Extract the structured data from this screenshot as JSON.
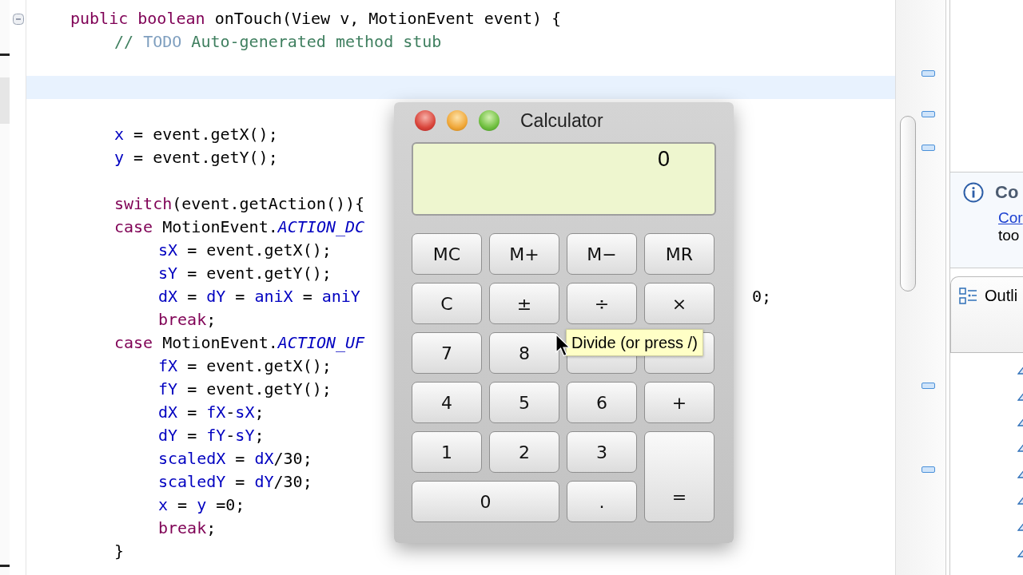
{
  "editor": {
    "lines": [
      {
        "current": false,
        "segments": [
          {
            "kind": "keyword",
            "text": "\tpublic boolean "
          },
          {
            "kind": "plain",
            "text": "onTouch(View v, MotionEvent event) {"
          }
        ]
      },
      {
        "current": false,
        "segments": [
          {
            "kind": "comment",
            "text": "\t\t// "
          },
          {
            "kind": "todo",
            "text": "TODO"
          },
          {
            "kind": "comment",
            "text": " Auto-generated method stub"
          }
        ]
      },
      {
        "current": false
      },
      {
        "current": true
      },
      {
        "current": false
      },
      {
        "current": false,
        "segments": [
          {
            "kind": "field",
            "text": "\t\tx"
          },
          {
            "kind": "plain",
            "text": " = event.getX();"
          }
        ]
      },
      {
        "current": false,
        "segments": [
          {
            "kind": "field",
            "text": "\t\ty"
          },
          {
            "kind": "plain",
            "text": " = event.getY();"
          }
        ]
      },
      {
        "current": false
      },
      {
        "current": false,
        "segments": [
          {
            "kind": "keyword",
            "text": "\t\tswitch"
          },
          {
            "kind": "plain",
            "text": "(event.getAction()){"
          }
        ]
      },
      {
        "current": false,
        "segments": [
          {
            "kind": "keyword",
            "text": "\t\tcase "
          },
          {
            "kind": "plain",
            "text": "MotionEvent."
          },
          {
            "kind": "constant",
            "text": "ACTION_DC"
          }
        ]
      },
      {
        "current": false,
        "segments": [
          {
            "kind": "field",
            "text": "\t\t\tsX"
          },
          {
            "kind": "plain",
            "text": " = event.getX();"
          }
        ]
      },
      {
        "current": false,
        "segments": [
          {
            "kind": "field",
            "text": "\t\t\tsY"
          },
          {
            "kind": "plain",
            "text": " = event.getY();"
          }
        ]
      },
      {
        "current": false,
        "segments": [
          {
            "kind": "field",
            "text": "\t\t\tdX"
          },
          {
            "kind": "plain",
            "text": " = "
          },
          {
            "kind": "field",
            "text": "dY"
          },
          {
            "kind": "plain",
            "text": " = "
          },
          {
            "kind": "field",
            "text": "aniX"
          },
          {
            "kind": "plain",
            "text": " = "
          },
          {
            "kind": "field",
            "text": "aniY"
          },
          {
            "kind": "tail",
            "text": "0;"
          }
        ]
      },
      {
        "current": false,
        "segments": [
          {
            "kind": "keyword",
            "text": "\t\t\tbreak"
          },
          {
            "kind": "plain",
            "text": ";"
          }
        ]
      },
      {
        "current": false,
        "segments": [
          {
            "kind": "keyword",
            "text": "\t\tcase "
          },
          {
            "kind": "plain",
            "text": "MotionEvent."
          },
          {
            "kind": "constant",
            "text": "ACTION_UF"
          }
        ]
      },
      {
        "current": false,
        "segments": [
          {
            "kind": "field",
            "text": "\t\t\tfX"
          },
          {
            "kind": "plain",
            "text": " = event.getX();"
          }
        ]
      },
      {
        "current": false,
        "segments": [
          {
            "kind": "field",
            "text": "\t\t\tfY"
          },
          {
            "kind": "plain",
            "text": " = event.getY();"
          }
        ]
      },
      {
        "current": false,
        "segments": [
          {
            "kind": "field",
            "text": "\t\t\tdX"
          },
          {
            "kind": "plain",
            "text": " = "
          },
          {
            "kind": "field",
            "text": "fX"
          },
          {
            "kind": "plain",
            "text": "-"
          },
          {
            "kind": "field",
            "text": "sX"
          },
          {
            "kind": "plain",
            "text": ";"
          }
        ]
      },
      {
        "current": false,
        "segments": [
          {
            "kind": "field",
            "text": "\t\t\tdY"
          },
          {
            "kind": "plain",
            "text": " = "
          },
          {
            "kind": "field",
            "text": "fY"
          },
          {
            "kind": "plain",
            "text": "-"
          },
          {
            "kind": "field",
            "text": "sY"
          },
          {
            "kind": "plain",
            "text": ";"
          }
        ]
      },
      {
        "current": false,
        "segments": [
          {
            "kind": "field",
            "text": "\t\t\tscaledX"
          },
          {
            "kind": "plain",
            "text": " = "
          },
          {
            "kind": "field",
            "text": "dX"
          },
          {
            "kind": "plain",
            "text": "/30;"
          }
        ]
      },
      {
        "current": false,
        "segments": [
          {
            "kind": "field",
            "text": "\t\t\tscaledY"
          },
          {
            "kind": "plain",
            "text": " = "
          },
          {
            "kind": "field",
            "text": "dY"
          },
          {
            "kind": "plain",
            "text": "/30;"
          }
        ]
      },
      {
        "current": false,
        "segments": [
          {
            "kind": "field",
            "text": "\t\t\tx"
          },
          {
            "kind": "plain",
            "text": " = "
          },
          {
            "kind": "field",
            "text": "y"
          },
          {
            "kind": "plain",
            "text": " =0;"
          }
        ]
      },
      {
        "current": false,
        "segments": [
          {
            "kind": "keyword",
            "text": "\t\t\tbreak"
          },
          {
            "kind": "plain",
            "text": ";"
          }
        ]
      },
      {
        "current": false,
        "segments": [
          {
            "kind": "plain",
            "text": "\t\t}"
          }
        ]
      }
    ]
  },
  "calculator": {
    "title": "Calculator",
    "display": "0",
    "tooltip": "Divide (or press /)",
    "keys": [
      {
        "kind": "key",
        "label": "MC"
      },
      {
        "kind": "key",
        "label": "M+"
      },
      {
        "kind": "key",
        "label": "M−"
      },
      {
        "kind": "key",
        "label": "MR"
      },
      {
        "kind": "key",
        "label": "C"
      },
      {
        "kind": "key",
        "label": "±"
      },
      {
        "kind": "key",
        "label": "÷"
      },
      {
        "kind": "key",
        "label": "×"
      },
      {
        "kind": "key",
        "label": "7"
      },
      {
        "kind": "key",
        "label": "8"
      },
      {
        "kind": "covered"
      },
      {
        "kind": "covered"
      },
      {
        "kind": "key",
        "label": "4"
      },
      {
        "kind": "key",
        "label": "5"
      },
      {
        "kind": "key",
        "label": "6"
      },
      {
        "kind": "key",
        "label": "+"
      },
      {
        "kind": "key",
        "label": "1"
      },
      {
        "kind": "key",
        "label": "2"
      },
      {
        "kind": "key",
        "label": "3"
      },
      {
        "kind": "wide",
        "label": "0"
      },
      {
        "kind": "key",
        "label": "."
      },
      {
        "kind": "tall",
        "label": "="
      }
    ]
  },
  "side_panel": {
    "info": {
      "title": "Co",
      "link": "Cor",
      "text": "too"
    },
    "outline": {
      "title": "Outli"
    }
  }
}
